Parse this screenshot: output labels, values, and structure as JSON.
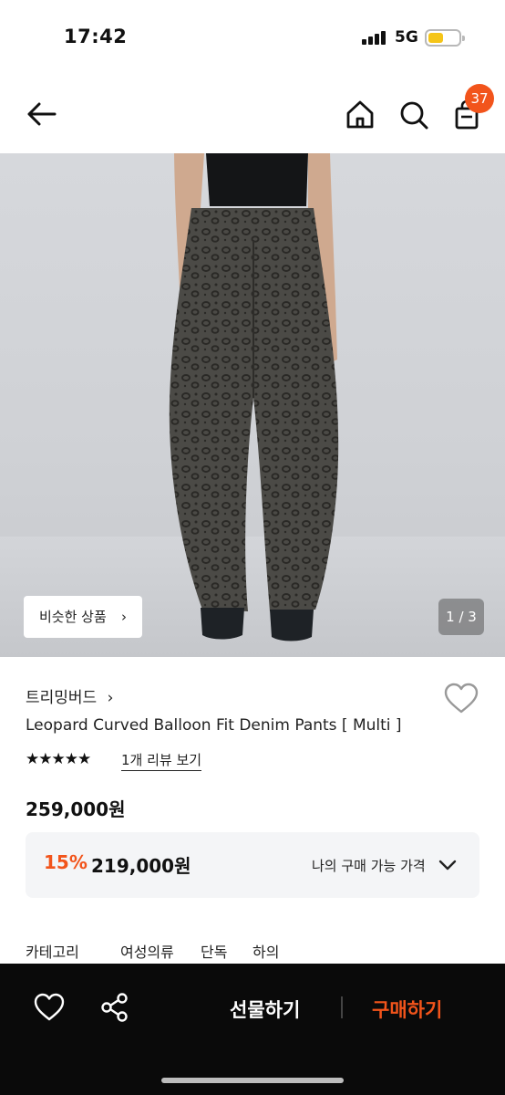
{
  "status_bar": {
    "time": "17:42",
    "network": "5G",
    "battery_level": 0.4,
    "battery_color": "#f5c518"
  },
  "header": {
    "cart_count": "37",
    "badge_color": "#f2541b",
    "icons": [
      "back-arrow-icon",
      "home-icon",
      "search-icon",
      "shopping-bag-icon"
    ]
  },
  "gallery": {
    "similar_button": "비슷한 상품",
    "page_indicator": "1 / 3"
  },
  "product": {
    "brand": "트리밍버드",
    "name": "Leopard Curved Balloon Fit Denim Pants [ Multi ]",
    "stars": "★★★★★",
    "rating": 5,
    "review_link": "1개 리뷰 보기",
    "original_price": "259,000원",
    "discount": "15%",
    "sale_price": "219,000원",
    "my_price_label": "나의 구매 가능 가격"
  },
  "category": {
    "label": "카테고리",
    "items": [
      "여성의류",
      "단독",
      "하의"
    ]
  },
  "bottom_bar": {
    "gift_label": "선물하기",
    "buy_label": "구매하기",
    "accent_color": "#f2541b"
  }
}
